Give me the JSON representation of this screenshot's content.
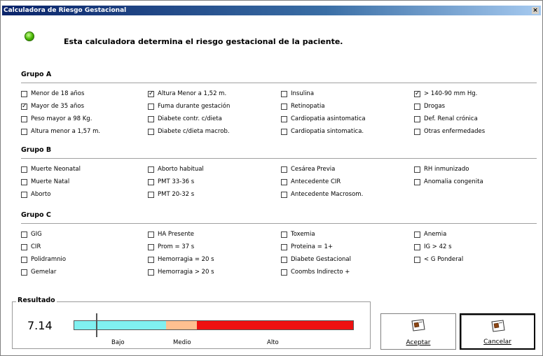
{
  "window": {
    "title": "Calculadora de Riesgo Gestacional",
    "close": "×"
  },
  "intro": "Esta calculadora determina el riesgo  gestacional de la paciente.",
  "groups": [
    {
      "title": "Grupo A",
      "columns": [
        [
          {
            "label": "Menor de 18 años",
            "checked": false
          },
          {
            "label": "Mayor de 35 años",
            "checked": true
          },
          {
            "label": "Peso mayor a 98 Kg.",
            "checked": false
          },
          {
            "label": "Altura menor a 1,57 m.",
            "checked": false
          }
        ],
        [
          {
            "label": "Altura Menor a 1,52 m.",
            "checked": true
          },
          {
            "label": "Fuma durante gestación",
            "checked": false
          },
          {
            "label": "Diabete contr. c/dieta",
            "checked": false
          },
          {
            "label": "Diabete c/dieta macrob.",
            "checked": false
          }
        ],
        [
          {
            "label": "Insulina",
            "checked": false
          },
          {
            "label": "Retinopatia",
            "checked": false
          },
          {
            "label": "Cardiopatia asintomatica",
            "checked": false
          },
          {
            "label": "Cardiopatia sintomatica.",
            "checked": false
          }
        ],
        [
          {
            "label": "> 140-90 mm Hg.",
            "checked": true
          },
          {
            "label": "Drogas",
            "checked": false
          },
          {
            "label": "Def. Renal crónica",
            "checked": false
          },
          {
            "label": "Otras enfermedades",
            "checked": false
          }
        ]
      ]
    },
    {
      "title": "Grupo B",
      "columns": [
        [
          {
            "label": "Muerte Neonatal",
            "checked": false
          },
          {
            "label": "Muerte Natal",
            "checked": false
          },
          {
            "label": "Aborto",
            "checked": false
          }
        ],
        [
          {
            "label": "Aborto habitual",
            "checked": false
          },
          {
            "label": "PMT 33-36 s",
            "checked": false
          },
          {
            "label": "PMT 20-32 s",
            "checked": false
          }
        ],
        [
          {
            "label": "Cesárea Previa",
            "checked": false
          },
          {
            "label": "Antecedente CIR",
            "checked": false
          },
          {
            "label": "Antecedente Macrosom.",
            "checked": false
          }
        ],
        [
          {
            "label": "RH inmunizado",
            "checked": false
          },
          {
            "label": "Anomalia congenita",
            "checked": false
          }
        ]
      ]
    },
    {
      "title": "Grupo C",
      "columns": [
        [
          {
            "label": "GIG",
            "checked": false
          },
          {
            "label": "CIR",
            "checked": false
          },
          {
            "label": "Polidramnio",
            "checked": false
          },
          {
            "label": "Gemelar",
            "checked": false
          }
        ],
        [
          {
            "label": "HA Presente",
            "checked": false
          },
          {
            "label": "Prom = 37 s",
            "checked": false
          },
          {
            "label": "Hemorragia = 20 s",
            "checked": false
          },
          {
            "label": "Hemorragia > 20 s",
            "checked": false
          }
        ],
        [
          {
            "label": "Toxemia",
            "checked": false
          },
          {
            "label": "Proteina = 1+",
            "checked": false
          },
          {
            "label": "Diabete Gestacional",
            "checked": false
          },
          {
            "label": "Coombs Indirecto +",
            "checked": false
          }
        ],
        [
          {
            "label": "Anemia",
            "checked": false
          },
          {
            "label": "IG > 42 s",
            "checked": false
          },
          {
            "label": "< G Ponderal",
            "checked": false
          }
        ]
      ]
    }
  ],
  "result": {
    "title": "Resultado",
    "value": "7.14",
    "indicator_fraction": 0.08,
    "segments": [
      {
        "label": "Bajo",
        "fraction": 0.33,
        "color": "#80f0f0"
      },
      {
        "label": "Medio",
        "fraction": 0.11,
        "color": "#ffc090"
      },
      {
        "label": "Alto",
        "fraction": 0.56,
        "color": "#ee1111"
      }
    ]
  },
  "buttons": {
    "accept": "Aceptar",
    "cancel": "Cancelar"
  }
}
